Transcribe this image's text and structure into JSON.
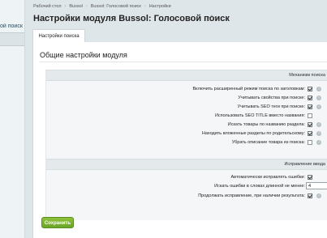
{
  "left_panel": {
    "items": [
      {
        "label": "ой поиск"
      },
      {
        "label": ""
      }
    ]
  },
  "breadcrumb": [
    "Рабочий стол",
    "Bussol",
    "Bussol: Голосовой поиск",
    "Настройки"
  ],
  "page": {
    "title": "Настройки модуля Bussol: Голосовой поиск",
    "favorite_icon": "star-outline-icon"
  },
  "tabs": [
    {
      "label": "Настройки поиска"
    }
  ],
  "section_title": "Общие настройки модуля",
  "groups": [
    {
      "header": "Механизм поиска",
      "rows": [
        {
          "label": "Включить расширенный режим поиска по заголовкам:",
          "checked": true,
          "help": true
        },
        {
          "label": "Учитывать свойства при поиске:",
          "checked": true,
          "help": true
        },
        {
          "label": "Учитывать SEO теги при поиске:",
          "checked": true,
          "help": true
        },
        {
          "label": "Использовать SEO TITLE вместо названия:",
          "checked": false,
          "help": false
        },
        {
          "label": "Искать товары по названию раздела:",
          "checked": true,
          "help": true
        },
        {
          "label": "Находить вложенные разделы по родительскому:",
          "checked": true,
          "help": true
        },
        {
          "label": "Убрать описание товара из поиска:",
          "checked": false,
          "help": true
        }
      ]
    },
    {
      "header": "Исправление ввода",
      "rows": [
        {
          "label": "Автоматически исправлять ошибки:",
          "checked": true,
          "help": false
        },
        {
          "label": "Искать ошибки в словах длинной не менее:",
          "value": "4"
        },
        {
          "label": "Продолжать исправление, при наличии результата:",
          "checked": true,
          "help": true
        }
      ]
    }
  ],
  "save_button": "Сохранить",
  "help_glyph": "?"
}
